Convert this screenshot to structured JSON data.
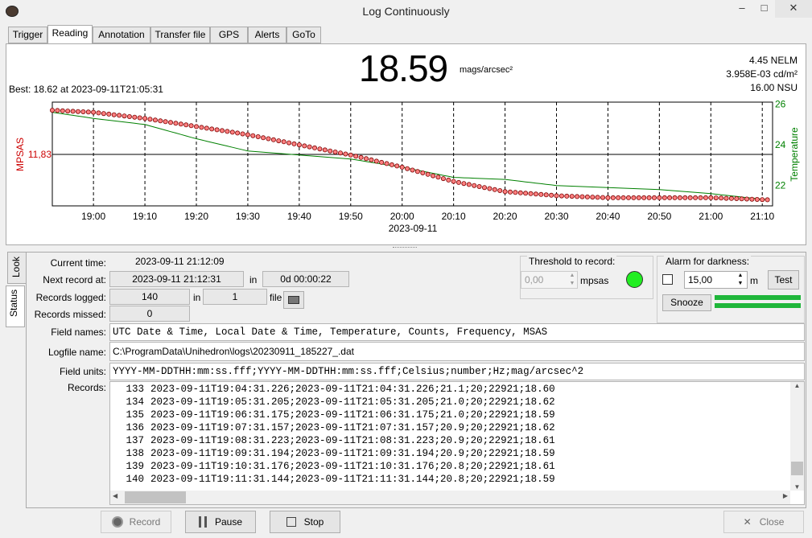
{
  "window": {
    "title": "Log Continuously",
    "minimize": "–",
    "maximize": "□",
    "close": "✕"
  },
  "tabs": [
    "Trigger",
    "Reading",
    "Annotation",
    "Transfer file",
    "GPS",
    "Alerts",
    "GoTo"
  ],
  "reading": {
    "value": "18.59",
    "unit": "mags/arcsec²",
    "best": "Best: 18.62 at 2023-09-11T21:05:31",
    "nelm": "4.45 NELM",
    "cdm": "3.958E-03 cd/m²",
    "nsu": "16.00 NSU"
  },
  "chart_data": {
    "type": "line",
    "x_tick_labels": [
      "19:00",
      "19:10",
      "19:20",
      "19:30",
      "19:40",
      "19:50",
      "20:00",
      "20:10",
      "20:20",
      "20:30",
      "20:40",
      "20:50",
      "21:00",
      "21:10"
    ],
    "x_date_label": "2023-09-11",
    "left_axis": {
      "label": "MPSAS",
      "marker_value": "11,83",
      "color": "#cc0000"
    },
    "right_axis": {
      "label": "Temperature",
      "ticks": [
        "26",
        "24",
        "22"
      ],
      "color": "#008000"
    },
    "series": [
      {
        "axis": "left",
        "color": "#cc0000",
        "marker": "circle",
        "x": [
          "18:52",
          "19:00",
          "19:10",
          "19:20",
          "19:30",
          "19:40",
          "19:50",
          "20:00",
          "20:10",
          "20:20",
          "20:30",
          "20:40",
          "20:50",
          "21:00",
          "21:11"
        ],
        "y": [
          25.7,
          25.6,
          25.3,
          24.9,
          24.5,
          24.0,
          23.5,
          22.9,
          22.2,
          21.7,
          21.5,
          21.4,
          21.4,
          21.4,
          21.3
        ]
      },
      {
        "axis": "right",
        "color": "#008000",
        "marker": "none",
        "x": [
          "18:52",
          "19:00",
          "19:10",
          "19:20",
          "19:30",
          "19:40",
          "19:50",
          "20:00",
          "20:10",
          "20:20",
          "20:30",
          "20:40",
          "20:50",
          "21:00",
          "21:11"
        ],
        "y": [
          25.6,
          25.3,
          25.0,
          24.3,
          23.7,
          23.5,
          23.3,
          22.9,
          22.4,
          22.3,
          22.0,
          21.9,
          21.8,
          21.6,
          21.3
        ]
      }
    ],
    "grid": "vertical dashed"
  },
  "side_tabs": [
    "Look",
    "Status"
  ],
  "status": {
    "current_time_label": "Current time:",
    "current_time": "2023-09-11 21:12:09",
    "next_record_label": "Next record at:",
    "next_record": "2023-09-11 21:12:31",
    "in_label": "in",
    "next_in": "0d 00:00:22",
    "records_logged_label": "Records logged:",
    "records_logged": "140",
    "in_label2": "in",
    "files": "1",
    "file_label": "file",
    "records_missed_label": "Records missed:",
    "records_missed": "0"
  },
  "threshold": {
    "title": "Threshold to record:",
    "value": "0,00",
    "unit": "mpsas",
    "indicator_color": "#22ee22"
  },
  "alarm": {
    "title": "Alarm for darkness:",
    "value": "15,00",
    "unit": "m",
    "test": "Test",
    "snooze": "Snooze",
    "checked": false
  },
  "fields": {
    "names_label": "Field names:",
    "names": "UTC Date & Time, Local Date & Time, Temperature, Counts, Frequency, MSAS",
    "logfile_label": "Logfile name:",
    "logfile": "C:\\ProgramData\\Unihedron\\logs\\20230911_185227_.dat",
    "units_label": "Field units:",
    "units": "YYYY-MM-DDTHH:mm:ss.fff;YYYY-MM-DDTHH:mm:ss.fff;Celsius;number;Hz;mag/arcsec^2",
    "records_label": "Records:"
  },
  "records": [
    {
      "n": "133",
      "text": "2023-09-11T19:04:31.226;2023-09-11T21:04:31.226;21.1;20;22921;18.60"
    },
    {
      "n": "134",
      "text": "2023-09-11T19:05:31.205;2023-09-11T21:05:31.205;21.0;20;22921;18.62"
    },
    {
      "n": "135",
      "text": "2023-09-11T19:06:31.175;2023-09-11T21:06:31.175;21.0;20;22921;18.59"
    },
    {
      "n": "136",
      "text": "2023-09-11T19:07:31.157;2023-09-11T21:07:31.157;20.9;20;22921;18.62"
    },
    {
      "n": "137",
      "text": "2023-09-11T19:08:31.223;2023-09-11T21:08:31.223;20.9;20;22921;18.61"
    },
    {
      "n": "138",
      "text": "2023-09-11T19:09:31.194;2023-09-11T21:09:31.194;20.9;20;22921;18.59"
    },
    {
      "n": "139",
      "text": "2023-09-11T19:10:31.176;2023-09-11T21:10:31.176;20.8;20;22921;18.61"
    },
    {
      "n": "140",
      "text": "2023-09-11T19:11:31.144;2023-09-11T21:11:31.144;20.8;20;22921;18.59"
    }
  ],
  "buttons": {
    "record": "Record",
    "pause": "Pause",
    "stop": "Stop",
    "close": "Close"
  }
}
